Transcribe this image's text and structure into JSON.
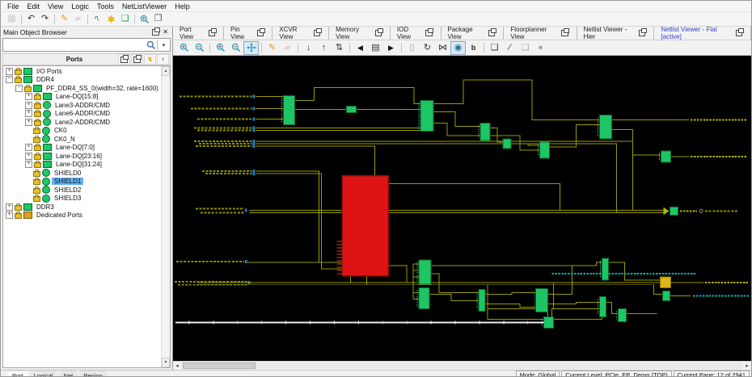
{
  "menu": {
    "items": [
      "File",
      "Edit",
      "View",
      "Logic",
      "Tools",
      "NetListViewer",
      "Help"
    ]
  },
  "toolbar": {
    "items": [
      {
        "name": "save-icon",
        "disabled": true
      },
      {
        "sep": true
      },
      {
        "name": "undo-icon"
      },
      {
        "name": "redo-icon"
      },
      {
        "sep": true
      },
      {
        "name": "edit-pencil-icon"
      },
      {
        "name": "eraser-icon",
        "disabled": true
      },
      {
        "sep": true
      },
      {
        "name": "pin-icon"
      },
      {
        "name": "options-icon"
      },
      {
        "name": "windows-icon"
      },
      {
        "sep": true
      },
      {
        "name": "zoom-in-icon"
      },
      {
        "name": "cascade-icon"
      }
    ]
  },
  "object_browser": {
    "title": "Main Object Browser",
    "titlebar_icons": [
      {
        "name": "float-icon"
      },
      {
        "name": "close-icon"
      }
    ],
    "search": {
      "value": "",
      "placeholder": ""
    },
    "header": "Ports",
    "header_icons": [
      {
        "name": "float-icon"
      },
      {
        "name": "copy-icon"
      },
      {
        "name": "filter-icon"
      },
      {
        "name": "scroll-top-icon"
      }
    ],
    "tree": [
      {
        "label": "I/O Ports",
        "depth": 0,
        "expander": "plus",
        "icon": "bus"
      },
      {
        "label": "DDR4",
        "depth": 0,
        "expander": "minus",
        "icon": "bus"
      },
      {
        "label": "PF_DDR4_SS_0(width=32, rate=1600)",
        "depth": 1,
        "expander": "minus",
        "icon": "bus"
      },
      {
        "label": "Lane-DQ[15:8]",
        "depth": 2,
        "expander": "plus",
        "icon": "bus"
      },
      {
        "label": "Lane3-ADDR/CMD",
        "depth": 2,
        "expander": "plus",
        "icon": "round"
      },
      {
        "label": "Lane6-ADDR/CMD",
        "depth": 2,
        "expander": "plus",
        "icon": "round"
      },
      {
        "label": "Lane2-ADDR/CMD",
        "depth": 2,
        "expander": "plus",
        "icon": "round"
      },
      {
        "label": "CK0",
        "depth": 2,
        "expander": null,
        "icon": "round"
      },
      {
        "label": "CK0_N",
        "depth": 2,
        "expander": null,
        "icon": "round"
      },
      {
        "label": "Lane-DQ[7:0]",
        "depth": 2,
        "expander": "plus",
        "icon": "bus"
      },
      {
        "label": "Lane-DQ[23:16]",
        "depth": 2,
        "expander": "plus",
        "icon": "bus"
      },
      {
        "label": "Lane-DQ[31:24]",
        "depth": 2,
        "expander": "plus",
        "icon": "bus"
      },
      {
        "label": "SHIELD0",
        "depth": 2,
        "expander": null,
        "icon": "round"
      },
      {
        "label": "SHIELD1",
        "depth": 2,
        "expander": null,
        "icon": "round",
        "selected": true
      },
      {
        "label": "SHIELD2",
        "depth": 2,
        "expander": null,
        "icon": "round"
      },
      {
        "label": "SHIELD3",
        "depth": 2,
        "expander": null,
        "icon": "round"
      },
      {
        "label": "DDR3",
        "depth": 0,
        "expander": "plus",
        "icon": "bus"
      },
      {
        "label": "Dedicated Ports",
        "depth": 0,
        "expander": "plus",
        "icon": "dedicated"
      }
    ],
    "bottom_tabs": [
      {
        "label": "Port",
        "active": true
      },
      {
        "label": "Logical"
      },
      {
        "label": "Net"
      },
      {
        "label": "Region"
      }
    ]
  },
  "view_tabs": [
    {
      "label": "Port View"
    },
    {
      "label": "Pin View"
    },
    {
      "label": "XCVR View"
    },
    {
      "label": "Memory View"
    },
    {
      "label": "IOD View"
    },
    {
      "label": "Package View"
    },
    {
      "label": "Floorplanner View"
    },
    {
      "label": "Netlist Viewer - Hier"
    },
    {
      "label": "Netlist Viewer - Flat [active]",
      "active": true
    }
  ],
  "canvas_toolbar": {
    "items": [
      {
        "name": "zoom-in-icon"
      },
      {
        "name": "zoom-out-icon"
      },
      {
        "sep": true
      },
      {
        "name": "zoom-selection-in-icon"
      },
      {
        "name": "zoom-selection-out-icon"
      },
      {
        "name": "fit-view-icon",
        "active": true
      },
      {
        "sep": true
      },
      {
        "name": "edit-pencil-icon"
      },
      {
        "name": "eraser-icon",
        "disabled": true
      },
      {
        "sep": true
      },
      {
        "name": "push-down-icon"
      },
      {
        "name": "pop-up-icon"
      },
      {
        "name": "push-pop-icon"
      },
      {
        "sep": true
      },
      {
        "name": "prev-page-icon"
      },
      {
        "name": "page-list-icon"
      },
      {
        "name": "next-page-icon"
      },
      {
        "sep": true
      },
      {
        "name": "new-sheet-icon",
        "disabled": true
      },
      {
        "name": "reload-icon"
      },
      {
        "name": "collapse-net-icon"
      },
      {
        "name": "show-flat-icon",
        "active": true
      },
      {
        "name": "show-buffers-icon"
      },
      {
        "sep": true
      },
      {
        "name": "add-note-icon"
      },
      {
        "name": "draw-line-icon"
      },
      {
        "name": "export-sheet-icon",
        "disabled": true
      },
      {
        "name": "record-icon",
        "disabled": true
      }
    ]
  },
  "statusbar": {
    "mode": "Mode: Global",
    "level": "Current Level:  PCIe_EP_Demo (TOP)",
    "page": "Current Page:  12 of 2941"
  }
}
